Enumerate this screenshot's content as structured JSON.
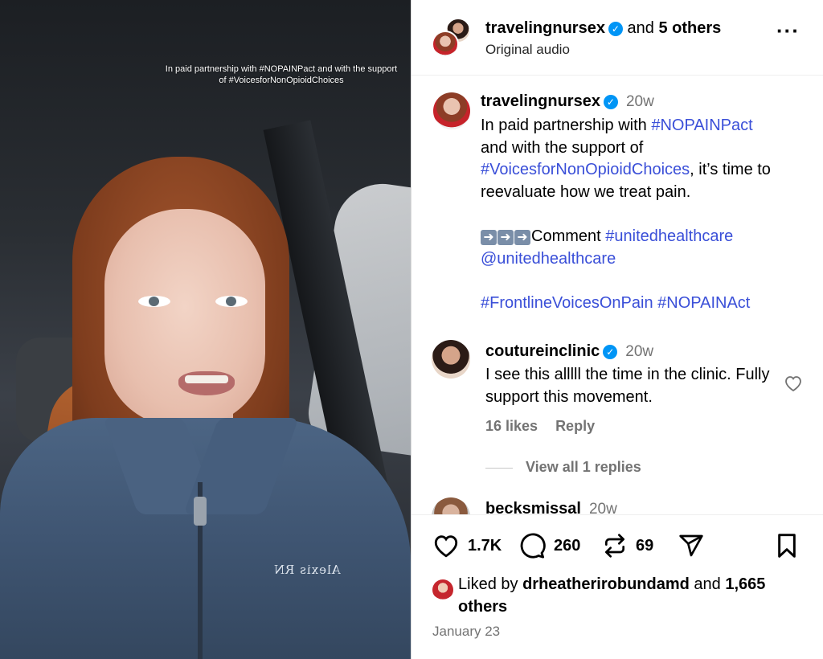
{
  "video": {
    "overlay_caption": "In paid partnership with #NOPAINPact and with the support of #VoicesforNonOpioidChoices",
    "jacket_text": "Alexis RN"
  },
  "header": {
    "username": "travelingnursex",
    "and_text": " and ",
    "others": "5 others",
    "subtitle": "Original audio",
    "more_icon": "ellipsis-icon"
  },
  "caption": {
    "username": "travelingnursex",
    "time": "20w",
    "line1_prefix": "In paid partnership with ",
    "tag1": "#NOPAINPact",
    "line2": "and with the support of",
    "tag2": "#VoicesforNonOpioidChoices",
    "line3_suffix": ", it’s time to reevaluate how we treat pain.",
    "arrows": "➡️➡️➡️",
    "comment_word": "Comment ",
    "tag3": "#unitedhealthcare",
    "mention": "@unitedhealthcare",
    "tag4": "#FrontlineVoicesOnPain",
    "tag5": "#NOPAINAct"
  },
  "comments": [
    {
      "username": "coutureinclinic",
      "verified": true,
      "time": "20w",
      "text": "I see this alllll the time in the clinic. Fully support this movement.",
      "likes": "16 likes",
      "reply": "Reply",
      "view_replies": "View all 1 replies"
    },
    {
      "username": "becksmissal",
      "time": "20w"
    }
  ],
  "actions": {
    "likes_count": "1.7K",
    "comments_count": "260",
    "reposts_count": "69"
  },
  "liked_by": {
    "prefix": "Liked by ",
    "user": "drheatherirobundamd",
    "and": " and ",
    "count": "1,665 others"
  },
  "date": "January 23",
  "colors": {
    "link": "#3a4fd8",
    "verified": "#0095f6",
    "muted": "#737373"
  }
}
